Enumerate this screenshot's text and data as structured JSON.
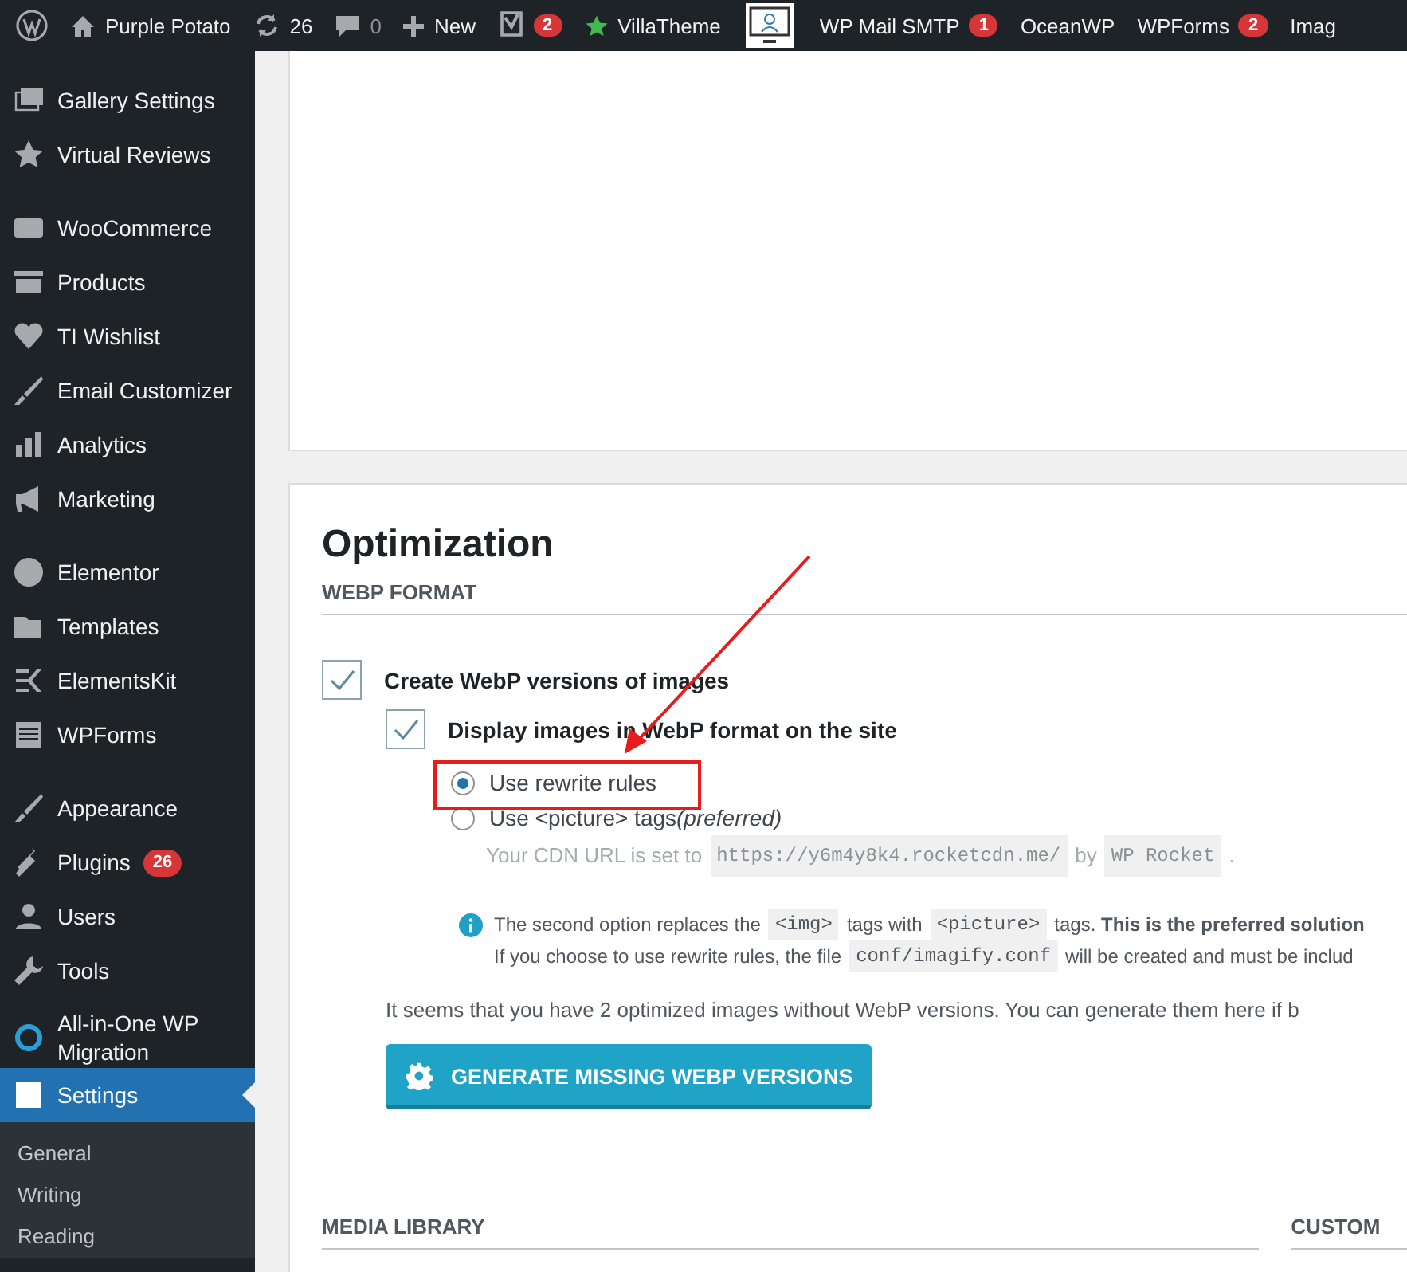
{
  "admin_bar": {
    "site": "Purple Potato",
    "updates": "26",
    "comments": "0",
    "new": "New",
    "yoast_badge": "2",
    "villatheme": "VillaTheme",
    "items": [
      {
        "label": "WP Mail SMTP",
        "badge": "1"
      },
      {
        "label": "OceanWP"
      },
      {
        "label": "WPForms",
        "badge": "2"
      },
      {
        "label": "Imag"
      }
    ]
  },
  "sidebar": {
    "groups": [
      [
        {
          "label": "Gallery Settings",
          "selected": false
        },
        {
          "label": "Virtual Reviews",
          "selected": false
        }
      ],
      [
        {
          "label": "WooCommerce",
          "selected": false
        },
        {
          "label": "Products",
          "selected": false
        },
        {
          "label": "TI Wishlist",
          "selected": false
        },
        {
          "label": "Email Customizer",
          "selected": false
        },
        {
          "label": "Analytics",
          "selected": false
        },
        {
          "label": "Marketing",
          "selected": false
        }
      ],
      [
        {
          "label": "Elementor",
          "selected": false
        },
        {
          "label": "Templates",
          "selected": false
        },
        {
          "label": "ElementsKit",
          "selected": false
        },
        {
          "label": "WPForms",
          "selected": false
        }
      ],
      [
        {
          "label": "Appearance",
          "selected": false
        },
        {
          "label": "Plugins",
          "selected": false,
          "badge": "26"
        },
        {
          "label": "Users",
          "selected": false
        },
        {
          "label": "Tools",
          "selected": false
        },
        {
          "label": "All-in-One WP Migration",
          "selected": false
        },
        {
          "label": "Settings",
          "selected": true
        }
      ]
    ],
    "submenu": [
      "General",
      "Writing",
      "Reading"
    ]
  },
  "optimization": {
    "title": "Optimization",
    "section": "WEBP FORMAT",
    "create_webp": {
      "label": "Create WebP versions of images",
      "checked": true
    },
    "display_webp": {
      "label": "Display images in WebP format on the site",
      "checked": true
    },
    "options": [
      {
        "label": "Use rewrite rules",
        "selected": true
      },
      {
        "label": "Use <picture> tags",
        "note": "(preferred)",
        "selected": false
      }
    ],
    "cdn": [
      {
        "kind": "text",
        "text": "Your CDN URL is set to"
      },
      {
        "kind": "code",
        "text": "https://y6m4y8k4.rocketcdn.me/"
      },
      {
        "kind": "text",
        "text": "by"
      },
      {
        "kind": "code",
        "text": "WP Rocket"
      },
      {
        "kind": "text",
        "text": "."
      }
    ],
    "info_lines": [
      [
        {
          "kind": "text",
          "text": "The second option replaces the"
        },
        {
          "kind": "code",
          "text": "<img>"
        },
        {
          "kind": "text",
          "text": "tags with"
        },
        {
          "kind": "code",
          "text": "<picture>"
        },
        {
          "kind": "text",
          "text": "tags. **This is the preferred solution**"
        }
      ],
      [
        {
          "kind": "text",
          "text": "If you choose to use rewrite rules, the file"
        },
        {
          "kind": "code",
          "text": "conf/imagify.conf"
        },
        {
          "kind": "text",
          "text": "will be created and must be includ"
        }
      ]
    ],
    "missing_note": "It seems that you have 2 optimized images without WebP versions. You can generate them here if b",
    "generate_button": "GENERATE MISSING WEBP VERSIONS",
    "media_library": "MEDIA LIBRARY",
    "custom": "CUSTOM"
  }
}
